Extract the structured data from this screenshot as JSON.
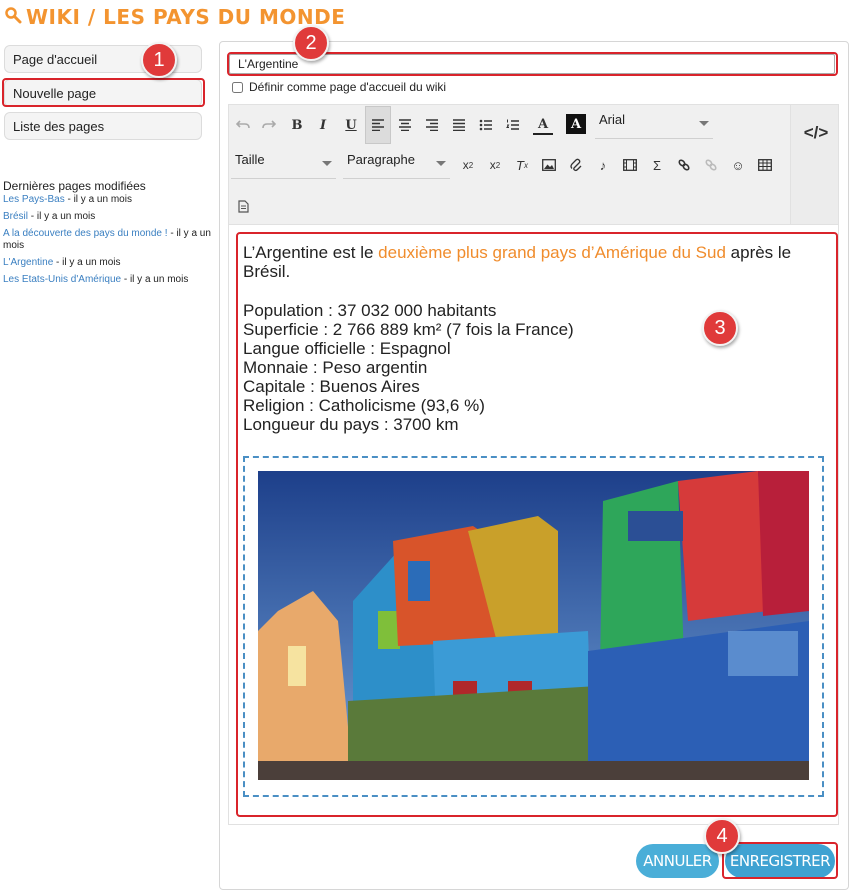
{
  "header": {
    "title": "WIKI / LES PAYS DU MONDE",
    "icon": "search-icon"
  },
  "sidebar": {
    "buttons": [
      {
        "label": "Page d'accueil"
      },
      {
        "label": "Nouvelle page"
      },
      {
        "label": "Liste des pages"
      }
    ],
    "recent_title": "Dernières pages modifiées",
    "recent": [
      {
        "title": "Les Pays-Bas",
        "meta": " - il y a un mois"
      },
      {
        "title": "Brésil",
        "meta": " - il y a un mois"
      },
      {
        "title": "A la découverte des pays du monde !",
        "meta": " - il y a un mois"
      },
      {
        "title": "L'Argentine",
        "meta": " - il y a un mois"
      },
      {
        "title": "Les Etats-Unis d'Amérique",
        "meta": " - il y a un mois"
      }
    ]
  },
  "form": {
    "title_value": "L'Argentine",
    "homepage_label": "Définir comme page d'accueil du wiki"
  },
  "toolbar": {
    "font_value": "Arial",
    "size_placeholder": "Taille",
    "format_value": "Paragraphe",
    "source_label": "</>"
  },
  "content": {
    "lead_before": "L’Argentine est le ",
    "lead_highlight": "deuxième plus grand pays d’Amérique du Sud",
    "lead_after": " après le Brésil.",
    "facts": [
      "Population : 37 032 000 habitants",
      "Superficie : 2 766 889  km² (7 fois la France)",
      "Langue officielle : Espagnol",
      "Monnaie : Peso argentin",
      "Capitale : Buenos Aires",
      "Religion : Catholicisme (93,6 %)",
      "Longueur du pays : 3700 km"
    ]
  },
  "actions": {
    "cancel_label": "ANNULER",
    "save_label": "ENREGISTRER"
  },
  "callouts": [
    "1",
    "2",
    "3",
    "4"
  ],
  "colors": {
    "accent": "#f39430",
    "link": "#3a7fc1",
    "button": "#3fa2d2",
    "highlight": "#d9242b"
  }
}
